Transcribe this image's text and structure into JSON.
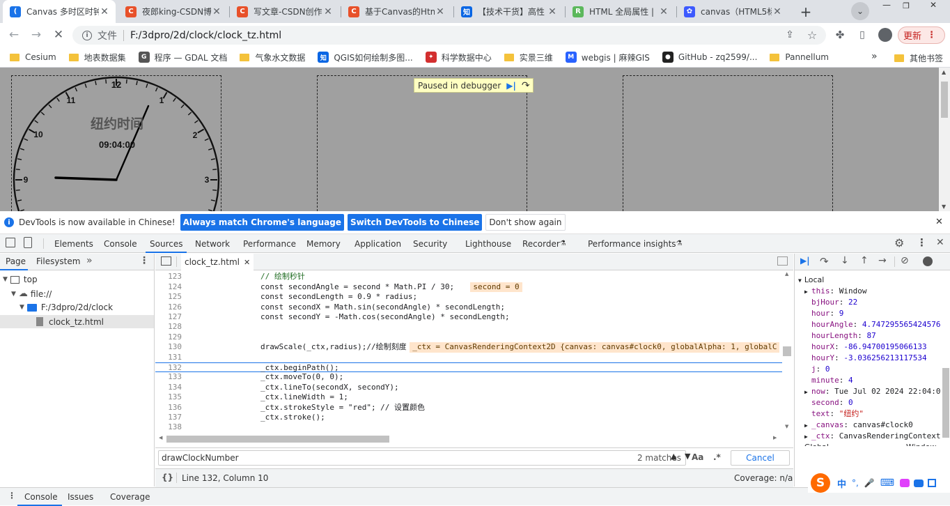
{
  "tabs": [
    {
      "title": "Canvas 多时区时钟",
      "color": "#1a73e8",
      "glyph": "(",
      "active": true
    },
    {
      "title": "夜郎king-CSDN博客",
      "color": "#e8512a",
      "glyph": "C"
    },
    {
      "title": "写文章-CSDN创作中心",
      "color": "#e8512a",
      "glyph": "C"
    },
    {
      "title": "基于Canvas的Html5",
      "color": "#e8512a",
      "glyph": "C"
    },
    {
      "title": "【技术干货】高性",
      "color": "#0a66e4",
      "glyph": "知"
    },
    {
      "title": "HTML 全局属性 |",
      "color": "#5cb85c",
      "glyph": "R"
    },
    {
      "title": "canvas（HTML5标",
      "color": "#3d5afe",
      "glyph": "✿"
    }
  ],
  "toolbar": {
    "file_label": "文件",
    "url": "F:/3dpro/2d/clock/clock_tz.html",
    "update_label": "更新"
  },
  "bookmarks": [
    {
      "label": "Cesium",
      "type": "folder"
    },
    {
      "label": "地表数据集",
      "type": "folder"
    },
    {
      "label": "程序 — GDAL 文档",
      "type": "gdal",
      "color": "#555",
      "glyph": "G"
    },
    {
      "label": "气象水文数据",
      "type": "folder"
    },
    {
      "label": "QGIS如何绘制多图...",
      "type": "zhihu",
      "color": "#0a66e4",
      "glyph": "知"
    },
    {
      "label": "科学数据中心",
      "type": "icon",
      "color": "#d32f2f",
      "glyph": "✦"
    },
    {
      "label": "实景三维",
      "type": "folder"
    },
    {
      "label": "webgis | 麻辣GIS",
      "type": "icon",
      "color": "#2962ff",
      "glyph": "M"
    },
    {
      "label": "GitHub - zq2599/...",
      "type": "icon",
      "color": "#222",
      "glyph": "●"
    },
    {
      "label": "Pannellum",
      "type": "folder"
    }
  ],
  "bookmarks_more": "»",
  "other_bookmarks": "其他书签",
  "clock": {
    "title": "纽约时间",
    "time": "09:04:00",
    "numbers": [
      "12",
      "1",
      "2",
      "3",
      "9",
      "10",
      "11"
    ]
  },
  "paused": "Paused in debugger",
  "infobar": {
    "text": "DevTools is now available in Chinese!",
    "btn1": "Always match Chrome's language",
    "btn2": "Switch DevTools to Chinese",
    "btn3": "Don't show again"
  },
  "devtools_tabs": [
    "Elements",
    "Console",
    "Sources",
    "Network",
    "Performance",
    "Memory",
    "Application",
    "Security",
    "Lighthouse",
    "Recorder",
    "Performance insights"
  ],
  "active_devtools_tab": "Sources",
  "navigator": {
    "tab1": "Page",
    "tab2": "Filesystem",
    "more": "»",
    "tree": [
      "top",
      "file://",
      "F:/3dpro/2d/clock",
      "clock_tz.html"
    ]
  },
  "editor": {
    "file_tab": "clock_tz.html",
    "lines": [
      {
        "n": "122",
        "code": ""
      },
      {
        "n": "123",
        "code": "// 绘制秒针",
        "cls": "cm"
      },
      {
        "n": "124",
        "code": "const secondAngle = second * Math.PI / 30;",
        "inline": "second = 0"
      },
      {
        "n": "125",
        "code": "const secondLength = 0.9 * radius;"
      },
      {
        "n": "126",
        "code": "const secondX = Math.sin(secondAngle) * secondLength;"
      },
      {
        "n": "127",
        "code": "const secondY = -Math.cos(secondAngle) * secondLength;"
      },
      {
        "n": "128",
        "code": ""
      },
      {
        "n": "129",
        "code": ""
      },
      {
        "n": "130",
        "code": "drawScale(_ctx,radius);//绘制刻度",
        "inline": "_ctx = CanvasRenderingContext2D {canvas: canvas#clock0, globalAlpha: 1, globalC"
      },
      {
        "n": "131",
        "code": ""
      },
      {
        "n": "132",
        "code": "_ctx.beginPath();",
        "current": true
      },
      {
        "n": "133",
        "code": "_ctx.moveTo(0, 0);"
      },
      {
        "n": "134",
        "code": "_ctx.lineTo(secondX, secondY);"
      },
      {
        "n": "135",
        "code": "_ctx.lineWidth = 1;"
      },
      {
        "n": "136",
        "code": "_ctx.strokeStyle = \"red\"; // 设置颜色"
      },
      {
        "n": "137",
        "code": "_ctx.stroke();"
      },
      {
        "n": "138",
        "code": ""
      }
    ],
    "search_value": "drawClockNumber",
    "matches": "2 matches",
    "case_label": "Aa",
    "regex_label": ".*",
    "cancel": "Cancel",
    "status": "Line 132, Column 10",
    "coverage": "Coverage: n/a"
  },
  "scope": {
    "local_label": "Local",
    "vars": [
      {
        "k": "this",
        "v": "Window",
        "exp": true
      },
      {
        "k": "bjHour",
        "v": "22",
        "t": "num"
      },
      {
        "k": "hour",
        "v": "9",
        "t": "num"
      },
      {
        "k": "hourAngle",
        "v": "4.747295565424576",
        "t": "num"
      },
      {
        "k": "hourLength",
        "v": "87",
        "t": "num"
      },
      {
        "k": "hourX",
        "v": "-86.94700195066133",
        "t": "num"
      },
      {
        "k": "hourY",
        "v": "-3.036256213117534",
        "t": "num"
      },
      {
        "k": "j",
        "v": "0",
        "t": "num"
      },
      {
        "k": "minute",
        "v": "4",
        "t": "num"
      },
      {
        "k": "now",
        "v": "Tue Jul 02 2024 22:04:0",
        "exp": true
      },
      {
        "k": "second",
        "v": "0",
        "t": "num"
      },
      {
        "k": "text",
        "v": "\"纽约\"",
        "t": "str"
      },
      {
        "k": "_canvas",
        "v": "canvas#clock0",
        "exp": true
      },
      {
        "k": "_ctx",
        "v": "CanvasRenderingContext",
        "exp": true
      }
    ],
    "global_label": "Global",
    "global_value": "Window",
    "callstack_label": "Call Stack"
  },
  "drawer": [
    "Console",
    "Issues",
    "Coverage"
  ],
  "ime": [
    "中",
    "°,",
    "🎤",
    "⌨"
  ]
}
